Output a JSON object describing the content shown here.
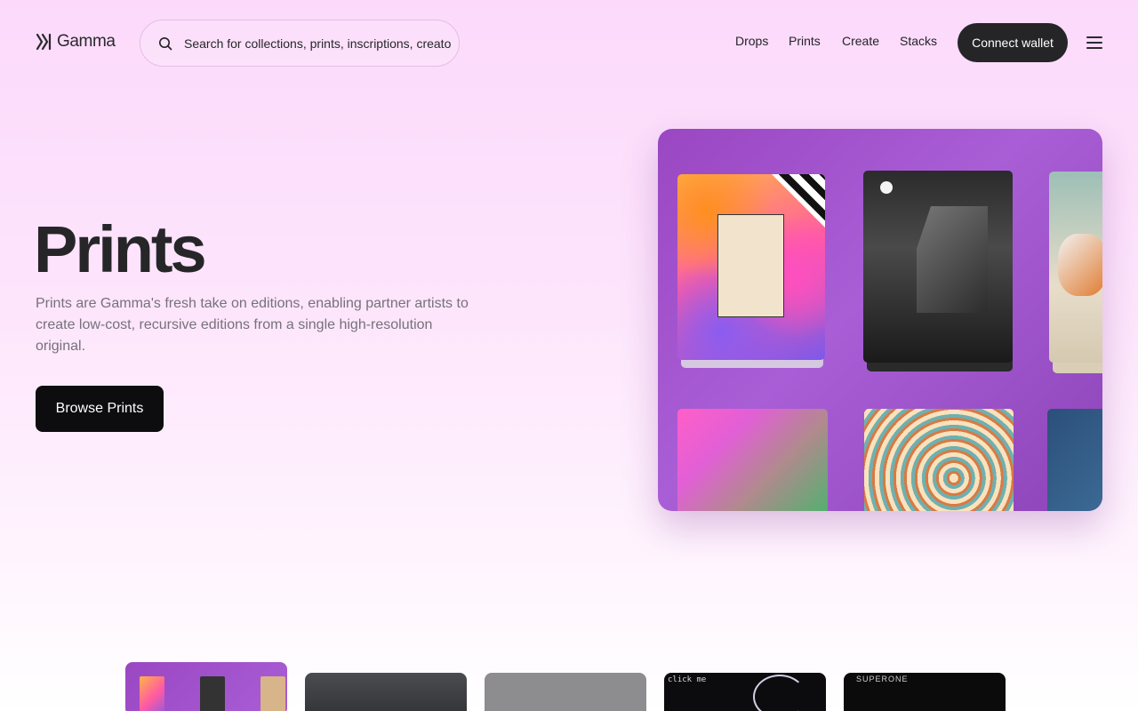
{
  "header": {
    "logo_text": "Gamma",
    "search_placeholder": "Search for collections, prints, inscriptions, creators",
    "nav": [
      "Drops",
      "Prints",
      "Create",
      "Stacks"
    ],
    "connect_label": "Connect wallet"
  },
  "hero": {
    "title": "Prints",
    "description": "Prints are Gamma's fresh take on editions, enabling partner artists to create low-cost, recursive editions from a single high-resolution original.",
    "cta_label": "Browse Prints"
  },
  "thumbnails": {
    "t4_text": "click me",
    "t5_text": "SUPERONE"
  },
  "colors": {
    "accent_purple": "#9a47c2",
    "button_dark": "#252528",
    "background_pink": "#fcd9fb"
  }
}
